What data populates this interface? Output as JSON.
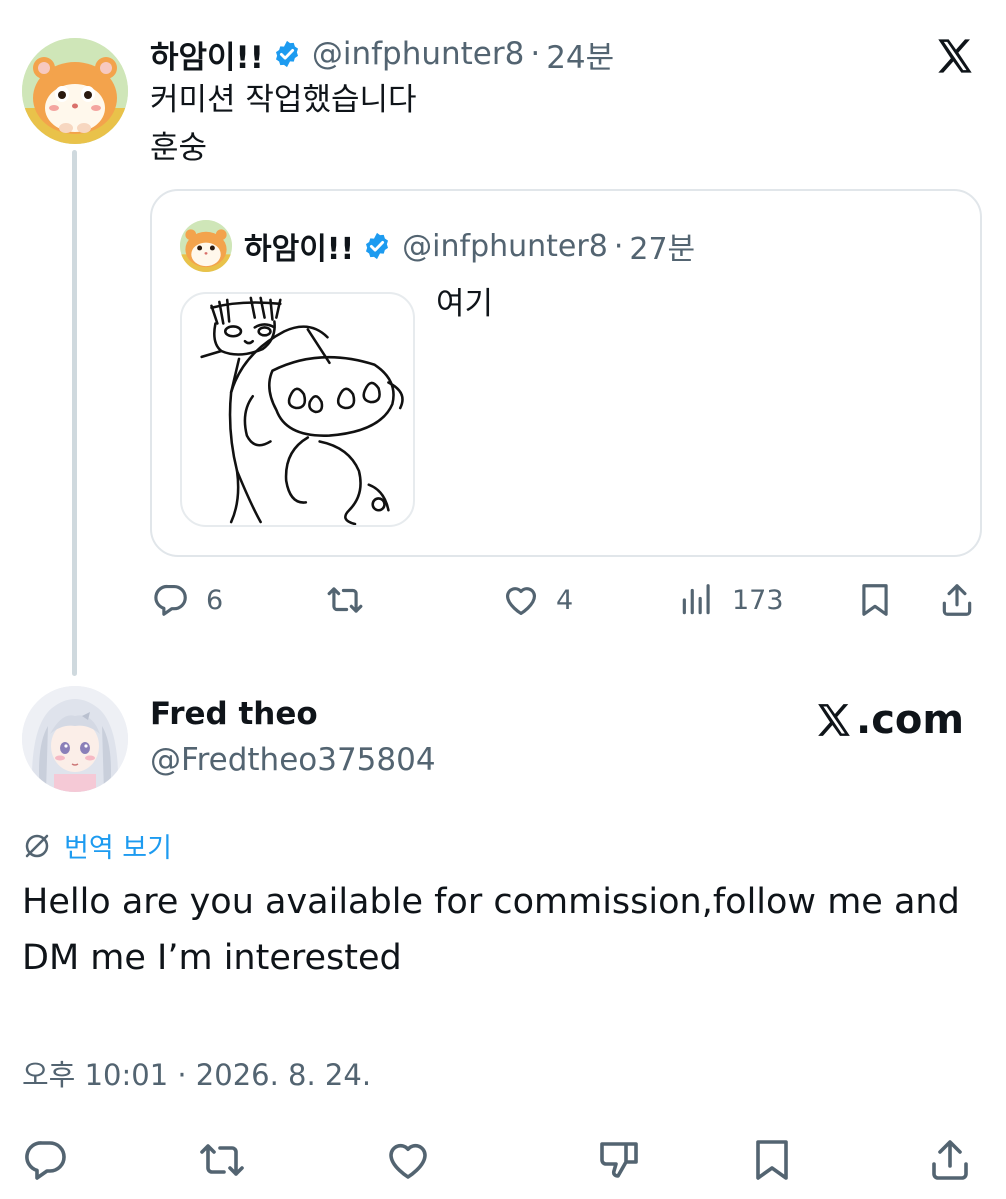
{
  "tweet": {
    "author_name": "하암이!!",
    "author_handle": "@infphunter8",
    "separator": "·",
    "time": "24분",
    "text_line1": "커미션 작업했습니다",
    "text_line2": "훈숭",
    "platform_icon": "x-logo-icon",
    "quote": {
      "author_name": "하암이!!",
      "author_handle": "@infphunter8",
      "separator": "·",
      "time": "27분",
      "text": "여기"
    },
    "actions": {
      "replies": "6",
      "reposts": "",
      "likes": "4",
      "views": "173"
    }
  },
  "reply": {
    "author_name": "Fred theo",
    "author_handle": "@Fredtheo375804",
    "brand_label": ".com",
    "translate_label": "번역 보기",
    "text": "Hello are you available for commission,follow me and DM me I’m interested",
    "timestamp": "오후 10:01 · 2026. 8. 24."
  },
  "colors": {
    "text": "#0f1419",
    "secondary": "#536471",
    "link": "#1d9bf0",
    "verified": "#1d9bf0",
    "border": "#e1e6ea"
  }
}
